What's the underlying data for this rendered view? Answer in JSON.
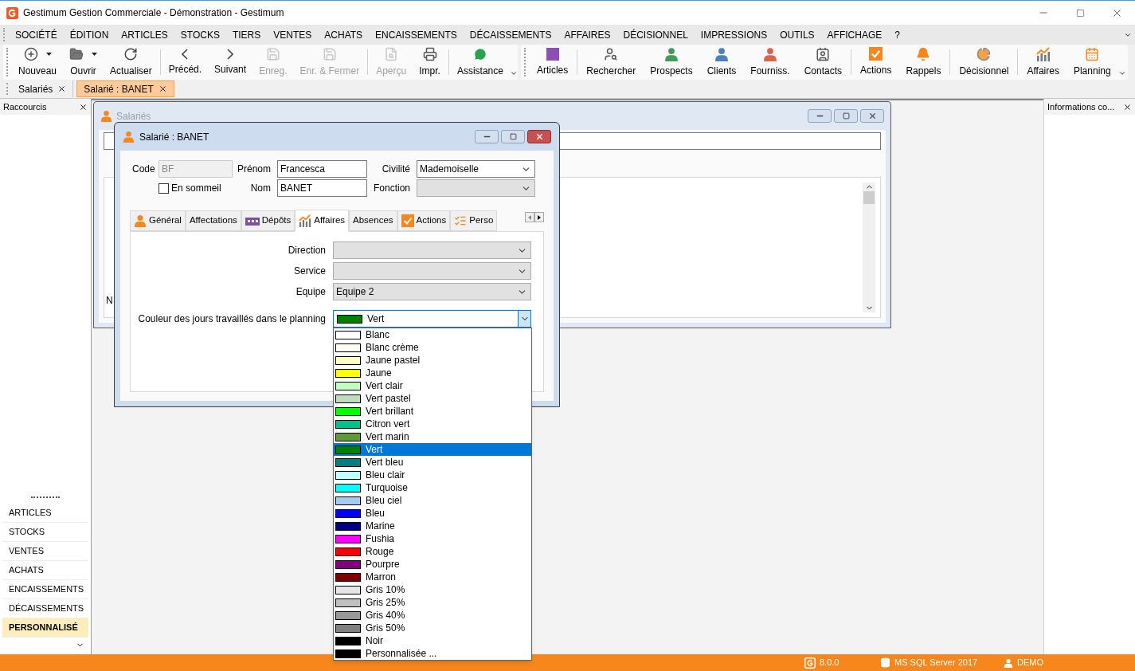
{
  "window": {
    "title": "Gestimum Gestion Commerciale - Démonstration - Gestimum"
  },
  "menu": [
    "SOCIÉTÉ",
    "ÉDITION",
    "ARTICLES",
    "STOCKS",
    "TIERS",
    "VENTES",
    "ACHATS",
    "ENCAISSEMENTS",
    "DÉCAISSEMENTS",
    "AFFAIRES",
    "DÉCISIONNEL",
    "IMPRESSIONS",
    "OUTILS",
    "AFFICHAGE",
    "?"
  ],
  "toolbar_main": [
    {
      "label": "Nouveau",
      "disabled": false,
      "dropdown": true,
      "separator_before": false
    },
    {
      "label": "Ouvrir",
      "disabled": false,
      "dropdown": true,
      "separator_before": false
    },
    {
      "label": "Actualiser",
      "disabled": false,
      "dropdown": false,
      "separator_before": false
    },
    {
      "label": "Précéd.",
      "disabled": false,
      "dropdown": false,
      "separator_before": true
    },
    {
      "label": "Suivant",
      "disabled": false,
      "dropdown": false,
      "separator_before": false
    },
    {
      "label": "Enreg.",
      "disabled": true,
      "dropdown": false,
      "separator_before": false
    },
    {
      "label": "Enr. & Fermer",
      "disabled": true,
      "dropdown": false,
      "separator_before": false
    },
    {
      "label": "Aperçu",
      "disabled": true,
      "dropdown": false,
      "separator_before": true
    },
    {
      "label": "Impr.",
      "disabled": false,
      "dropdown": false,
      "separator_before": false
    },
    {
      "label": "Assistance",
      "disabled": false,
      "dropdown": false,
      "separator_before": true
    }
  ],
  "toolbar_modules": [
    {
      "label": "Articles",
      "separator_before": false
    },
    {
      "label": "Rechercher",
      "separator_before": true
    },
    {
      "label": "Prospects",
      "separator_before": false
    },
    {
      "label": "Clients",
      "separator_before": false
    },
    {
      "label": "Fourniss.",
      "separator_before": false
    },
    {
      "label": "Contacts",
      "separator_before": false
    },
    {
      "label": "Actions",
      "separator_before": true
    },
    {
      "label": "Rappels",
      "separator_before": false
    },
    {
      "label": "Décisionnel",
      "separator_before": true
    },
    {
      "label": "Affaires",
      "separator_before": true
    },
    {
      "label": "Planning",
      "separator_before": false
    }
  ],
  "document_tabs": [
    {
      "label": "Salariés",
      "selected": false
    },
    {
      "label": "Salarié : BANET",
      "selected": true
    }
  ],
  "shortcuts_panel": {
    "title": "Raccourcis",
    "items": [
      {
        "label": "ARTICLES",
        "selected": false
      },
      {
        "label": "STOCKS",
        "selected": false
      },
      {
        "label": "VENTES",
        "selected": false
      },
      {
        "label": "ACHATS",
        "selected": false
      },
      {
        "label": "ENCAISSEMENTS",
        "selected": false
      },
      {
        "label": "DÉCAISSEMENTS",
        "selected": false
      },
      {
        "label": "PERSONNALISÉ",
        "selected": true
      }
    ]
  },
  "info_panel": {
    "title": "Informations co..."
  },
  "list_window": {
    "title": "Salariés",
    "column_1": "N"
  },
  "employee_window": {
    "title": "Salarié : BANET",
    "code": {
      "label": "Code",
      "value": "BF",
      "disabled": true
    },
    "first_name": {
      "label": "Prénom",
      "value": "Francesca"
    },
    "title_field": {
      "label": "Civilité",
      "value": "Mademoiselle"
    },
    "dormant": {
      "label": "En sommeil",
      "checked": false
    },
    "last_name": {
      "label": "Nom",
      "value": "BANET"
    },
    "function": {
      "label": "Fonction",
      "disabled": true
    },
    "tabs": [
      {
        "label": "Général",
        "selected": false
      },
      {
        "label": "Affectations",
        "selected": false
      },
      {
        "label": "Dépôts",
        "selected": false
      },
      {
        "label": "Affaires",
        "selected": true
      },
      {
        "label": "Absences",
        "selected": false
      },
      {
        "label": "Actions",
        "selected": false
      },
      {
        "label": "Perso",
        "selected": false
      }
    ],
    "business_fields": [
      {
        "label": "Direction"
      },
      {
        "label": "Service"
      },
      {
        "label": "Equipe",
        "value": "Equipe 2"
      }
    ],
    "color_field": {
      "label": "Couleur des jours travaillés dans le planning",
      "value": "Vert",
      "color": "#008000",
      "open": true
    },
    "color_options": [
      {
        "label": "Blanc",
        "color": "#ffffff",
        "selected": false
      },
      {
        "label": "Blanc crème",
        "color": "#fffbf0",
        "selected": false
      },
      {
        "label": "Jaune pastel",
        "color": "#ffffc0",
        "selected": false
      },
      {
        "label": "Jaune",
        "color": "#ffff00",
        "selected": false
      },
      {
        "label": "Vert clair",
        "color": "#c0ffc0",
        "selected": false
      },
      {
        "label": "Vert pastel",
        "color": "#c0dcc0",
        "selected": false
      },
      {
        "label": "Vert brillant",
        "color": "#00ff00",
        "selected": false
      },
      {
        "label": "Citron vert",
        "color": "#00c08c",
        "selected": false
      },
      {
        "label": "Vert marin",
        "color": "#5f9a3a",
        "selected": false
      },
      {
        "label": "Vert",
        "color": "#008000",
        "selected": true
      },
      {
        "label": "Vert bleu",
        "color": "#008080",
        "selected": false
      },
      {
        "label": "Bleu clair",
        "color": "#c0ffff",
        "selected": false
      },
      {
        "label": "Turquoise",
        "color": "#00ffff",
        "selected": false
      },
      {
        "label": "Bleu ciel",
        "color": "#a6caf0",
        "selected": false
      },
      {
        "label": "Bleu",
        "color": "#0000ff",
        "selected": false
      },
      {
        "label": "Marine",
        "color": "#000080",
        "selected": false
      },
      {
        "label": "Fushia",
        "color": "#ff00ff",
        "selected": false
      },
      {
        "label": "Rouge",
        "color": "#ff0000",
        "selected": false
      },
      {
        "label": "Pourpre",
        "color": "#800080",
        "selected": false
      },
      {
        "label": "Marron",
        "color": "#800000",
        "selected": false
      },
      {
        "label": "Gris 10%",
        "color": "#e6e6e6",
        "selected": false
      },
      {
        "label": "Gris 25%",
        "color": "#c0c0c0",
        "selected": false
      },
      {
        "label": "Gris 40%",
        "color": "#999999",
        "selected": false
      },
      {
        "label": "Gris 50%",
        "color": "#808080",
        "selected": false
      },
      {
        "label": "Noir",
        "color": "#000000",
        "selected": false
      },
      {
        "label": "Personnalisée ...",
        "color": "#000000",
        "selected": false
      }
    ]
  },
  "status_bar": [
    {
      "text": "8.0.0"
    },
    {
      "text": "MS SQL Server 2017"
    },
    {
      "text": "DEMO"
    }
  ]
}
